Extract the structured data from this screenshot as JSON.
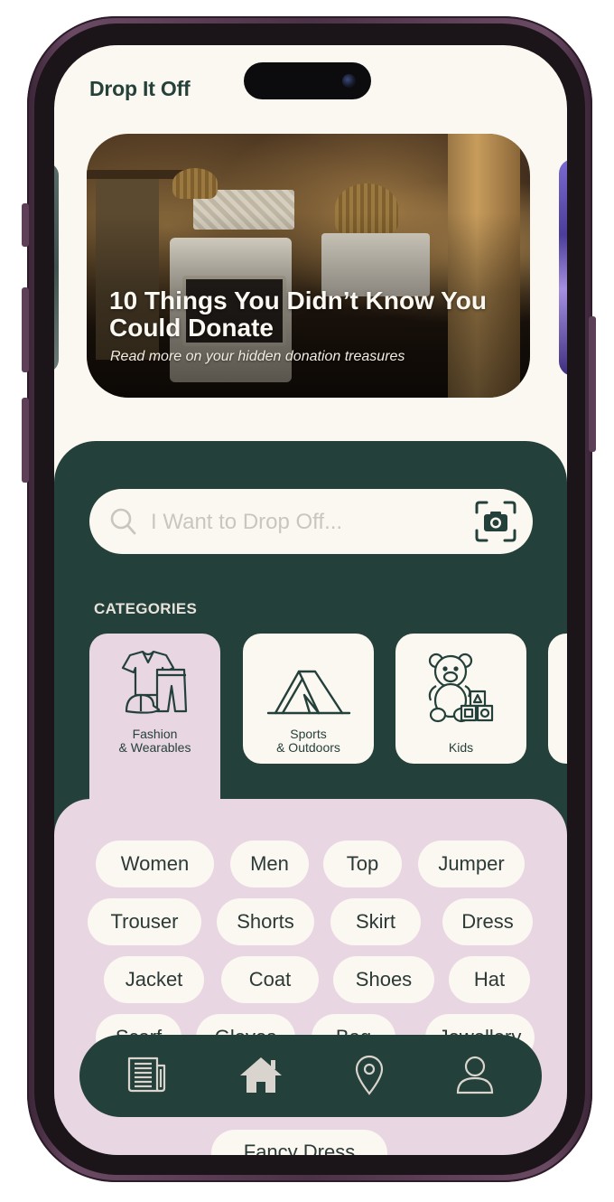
{
  "app": {
    "title": "Drop It Off"
  },
  "hero": {
    "title": "10 Things You Didn’t Know You Could Donate",
    "subtitle": "Read more on your hidden donation treasures"
  },
  "search": {
    "placeholder": "I Want to Drop Off...",
    "icon": "search-icon",
    "camera_icon": "camera-icon"
  },
  "categories": {
    "heading": "CATEGORIES",
    "items": [
      {
        "line1": "Fashion",
        "line2": "& Wearables",
        "icon": "clothing-icon",
        "selected": true
      },
      {
        "line1": "Sports",
        "line2": "& Outdoors",
        "icon": "tent-icon",
        "selected": false
      },
      {
        "line1": "",
        "line2": "Kids",
        "icon": "teddy-bear-icon",
        "selected": false
      }
    ]
  },
  "tags": [
    "Women",
    "Men",
    "Top",
    "Jumper",
    "Trouser",
    "Shorts",
    "Skirt",
    "Dress",
    "Jacket",
    "Coat",
    "Shoes",
    "Hat",
    "Scarf",
    "Gloves",
    "Bag",
    "Jewellery",
    "Fancy Dress"
  ],
  "nav": {
    "items": [
      {
        "icon": "newspaper-icon"
      },
      {
        "icon": "home-icon",
        "active": true
      },
      {
        "icon": "location-pin-icon"
      },
      {
        "icon": "profile-icon"
      }
    ]
  },
  "colors": {
    "dark_green": "#24403a",
    "cream": "#fbf7f1",
    "pink": "#e8d6e2",
    "frame": "#5d4057"
  }
}
